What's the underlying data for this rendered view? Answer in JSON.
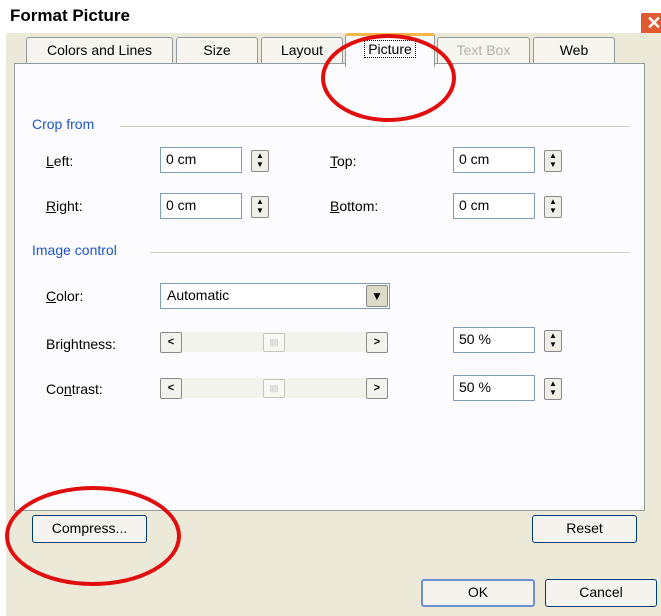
{
  "window": {
    "title": "Format Picture",
    "close_symbol": "✕"
  },
  "tabs": [
    {
      "label": "Colors and Lines",
      "state": "normal"
    },
    {
      "label": "Size",
      "state": "normal"
    },
    {
      "label": "Layout",
      "state": "normal"
    },
    {
      "label": "Picture",
      "state": "active"
    },
    {
      "label": "Text Box",
      "state": "disabled"
    },
    {
      "label": "Web",
      "state": "normal"
    }
  ],
  "crop_from": {
    "heading": "Crop from",
    "left": {
      "label": "Left:",
      "value": "0 cm"
    },
    "right": {
      "label": "Right:",
      "value": "0 cm"
    },
    "top": {
      "label": "Top:",
      "value": "0 cm"
    },
    "bottom": {
      "label": "Bottom:",
      "value": "0 cm"
    }
  },
  "image_control": {
    "heading": "Image control",
    "color": {
      "label": "Color:",
      "value": "Automatic"
    },
    "brightness": {
      "label": "Brightness:",
      "value": "50 %",
      "level_percent": 50
    },
    "contrast": {
      "label": "Contrast:",
      "value": "50 %",
      "level_percent": 50
    }
  },
  "buttons": {
    "compress": "Compress...",
    "reset": "Reset",
    "ok": "OK",
    "cancel": "Cancel"
  },
  "annotation_color": "#e20d0d"
}
